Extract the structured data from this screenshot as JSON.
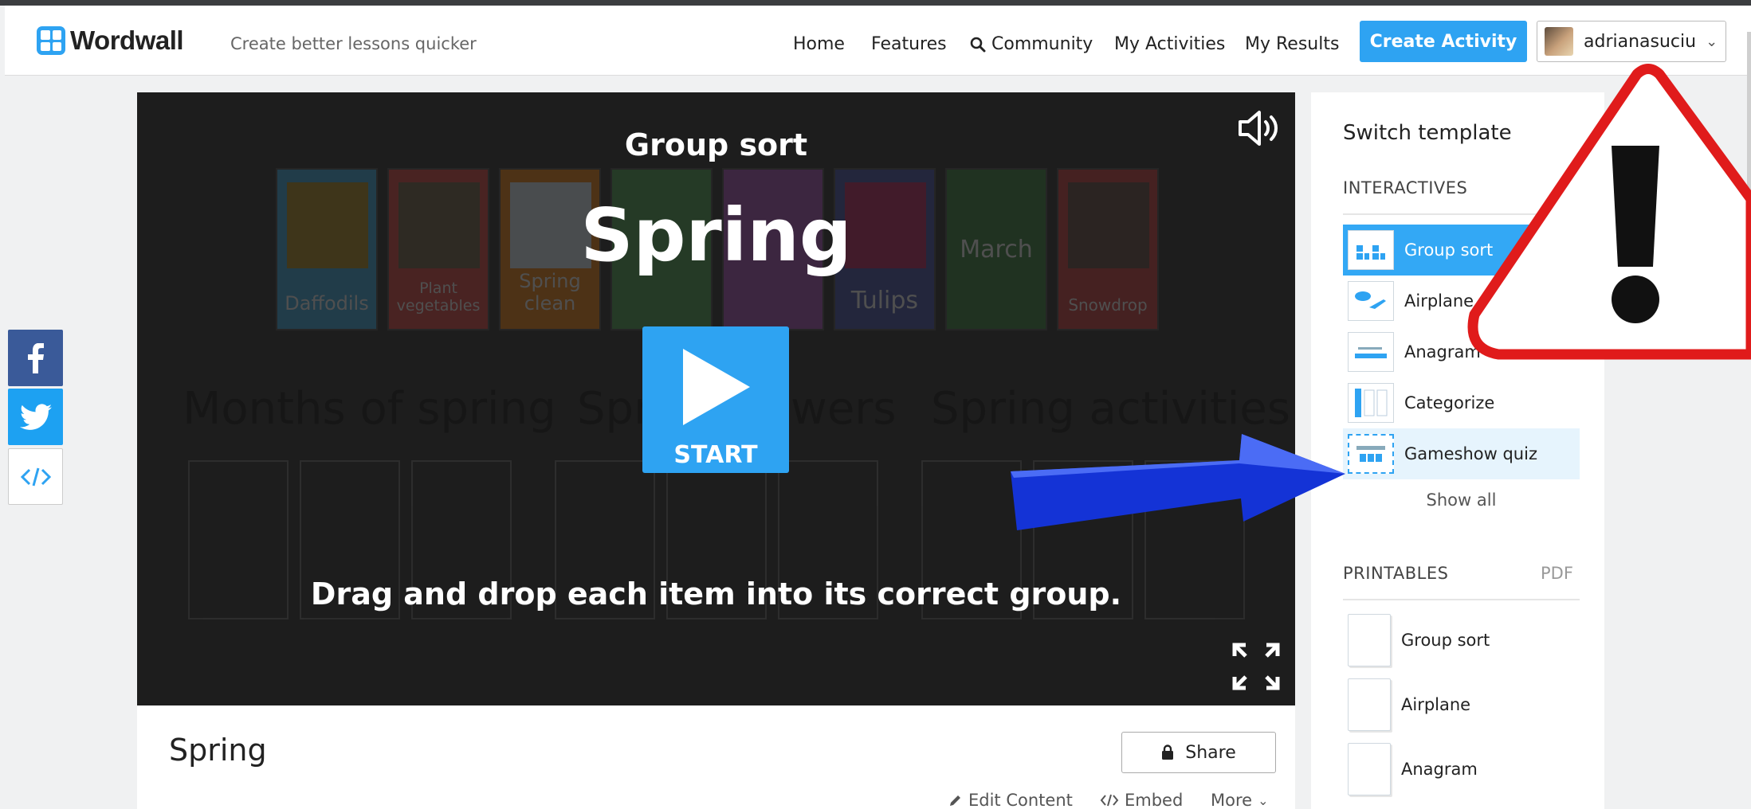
{
  "header": {
    "logo_text": "Wordwall",
    "tagline": "Create better lessons quicker",
    "nav": {
      "home": "Home",
      "features": "Features",
      "community": "Community",
      "my_activities": "My Activities",
      "my_results": "My Results"
    },
    "create_activity": "Create Activity",
    "username": "adrianasuciu"
  },
  "social": {
    "facebook_icon": "facebook-icon",
    "twitter_icon": "twitter-icon",
    "embed_icon": "code-icon"
  },
  "player": {
    "game_type": "Group sort",
    "title": "Spring",
    "start_label": "START",
    "instructions": "Drag and drop each item into its correct group.",
    "cards": [
      "Daffodils",
      "Plant vegetables",
      "Spring clean",
      "",
      "",
      "Tulips",
      "March",
      "Snowdrop"
    ],
    "groups": [
      "Months of spring",
      "Spring flowers",
      "Spring activities"
    ]
  },
  "activity": {
    "title": "Spring",
    "share": "Share",
    "edit_content": "Edit Content",
    "embed": "Embed",
    "more": "More"
  },
  "sidebar": {
    "title": "Switch template",
    "interactives_label": "INTERACTIVES",
    "interactives": [
      "Group sort",
      "Airplane",
      "Anagram",
      "Categorize",
      "Gameshow quiz"
    ],
    "show_all": "Show all",
    "printables_label": "PRINTABLES",
    "pdf_label": "PDF",
    "printables": [
      "Group sort",
      "Airplane",
      "Anagram"
    ]
  },
  "colors": {
    "brand_blue": "#2ea3f2",
    "active_template": "#33a8f5",
    "player_background": "#1d1d1d",
    "warning_red": "#e01b1b",
    "arrow_blue": "#1433d6"
  }
}
